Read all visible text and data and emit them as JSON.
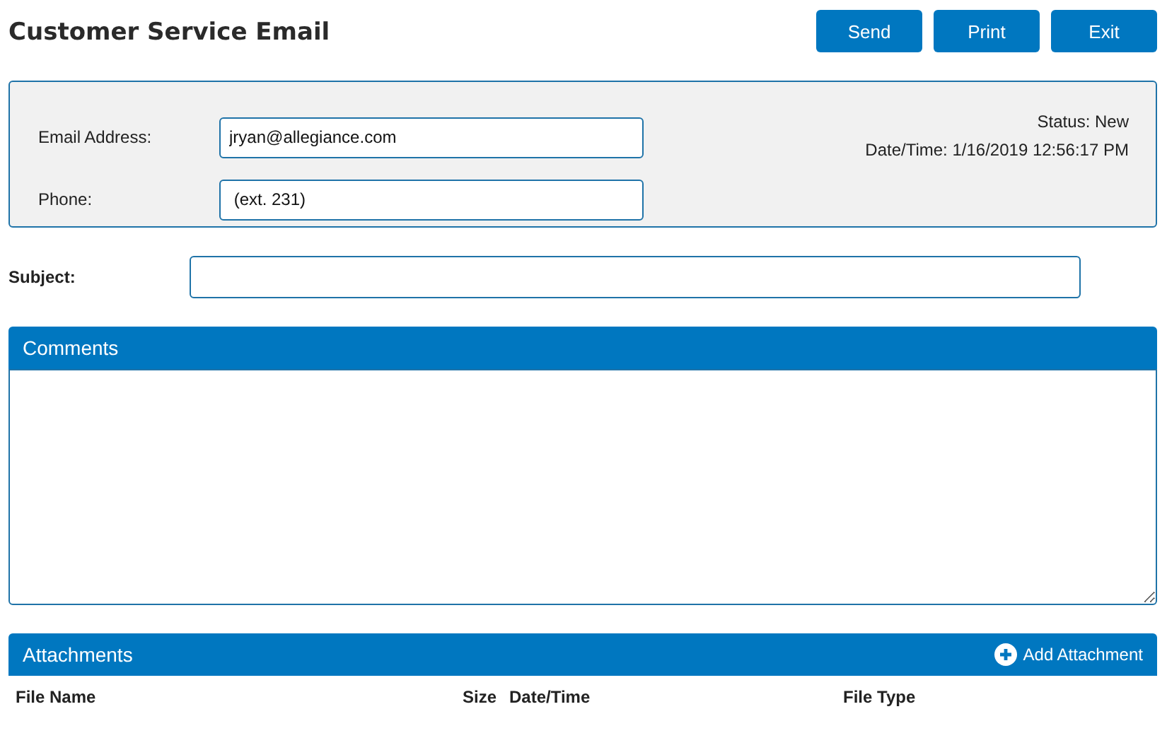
{
  "title": "Customer Service Email",
  "buttons": [
    "Send",
    "Print",
    "Exit"
  ],
  "info": {
    "email_label": "Email Address:",
    "email": "jryan@allegiance.com",
    "phone_label": "Phone:",
    "phone": " (ext. 231)",
    "status": "Status: New",
    "datetime": "Date/Time: 1/16/2019 12:56:17 PM"
  },
  "subject": {
    "label": "Subject:"
  },
  "comments": {
    "title": "Comments"
  },
  "attachments": {
    "title": "Attachments",
    "add": "Add Attachment",
    "columns": [
      "File Name",
      "Size",
      "Date/Time",
      "File Type"
    ]
  }
}
